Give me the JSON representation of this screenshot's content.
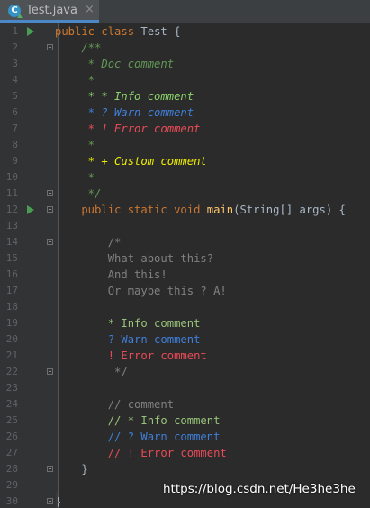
{
  "tab": {
    "title": "Test.java",
    "icon": "java-class-icon",
    "icon_letter": "C",
    "close": "×"
  },
  "colors": {
    "background": "#2b2b2b",
    "keyword": "#cc7832",
    "doc_comment": "#629755",
    "info": "#8bd46a",
    "warn": "#3f7fd9",
    "error": "#e84b57",
    "custom": "#f0f000"
  },
  "lines": [
    {
      "n": "1",
      "run": true,
      "fold": false,
      "tokens": [
        [
          "kw",
          "public class "
        ],
        [
          "plain",
          "Test {"
        ]
      ]
    },
    {
      "n": "2",
      "run": false,
      "fold": true,
      "tokens": [
        [
          "doc",
          "    /**"
        ]
      ]
    },
    {
      "n": "3",
      "run": false,
      "fold": false,
      "tokens": [
        [
          "doc",
          "     * Doc comment"
        ]
      ]
    },
    {
      "n": "4",
      "run": false,
      "fold": false,
      "tokens": [
        [
          "doc",
          "     *"
        ]
      ]
    },
    {
      "n": "5",
      "run": false,
      "fold": false,
      "tokens": [
        [
          "doc-info",
          "     * * Info comment"
        ]
      ]
    },
    {
      "n": "6",
      "run": false,
      "fold": false,
      "tokens": [
        [
          "doc-warn",
          "     * ? Warn comment"
        ]
      ]
    },
    {
      "n": "7",
      "run": false,
      "fold": false,
      "tokens": [
        [
          "doc-error",
          "     * ! Error comment"
        ]
      ]
    },
    {
      "n": "8",
      "run": false,
      "fold": false,
      "tokens": [
        [
          "doc",
          "     *"
        ]
      ]
    },
    {
      "n": "9",
      "run": false,
      "fold": false,
      "tokens": [
        [
          "doc-custom",
          "     * + Custom comment"
        ]
      ]
    },
    {
      "n": "10",
      "run": false,
      "fold": false,
      "tokens": [
        [
          "doc",
          "     *"
        ]
      ]
    },
    {
      "n": "11",
      "run": false,
      "fold": true,
      "tokens": [
        [
          "doc",
          "     */"
        ]
      ]
    },
    {
      "n": "12",
      "run": true,
      "fold": true,
      "tokens": [
        [
          "kw",
          "    public static void "
        ],
        [
          "fn",
          "main"
        ],
        [
          "plain",
          "(String[] args) {"
        ]
      ]
    },
    {
      "n": "13",
      "run": false,
      "fold": false,
      "tokens": [
        [
          "plain",
          ""
        ]
      ]
    },
    {
      "n": "14",
      "run": false,
      "fold": true,
      "tokens": [
        [
          "cm",
          "        /*"
        ]
      ]
    },
    {
      "n": "15",
      "run": false,
      "fold": false,
      "tokens": [
        [
          "cm",
          "        What about this?"
        ]
      ]
    },
    {
      "n": "16",
      "run": false,
      "fold": false,
      "tokens": [
        [
          "cm",
          "        And this!"
        ]
      ]
    },
    {
      "n": "17",
      "run": false,
      "fold": false,
      "tokens": [
        [
          "cm",
          "        Or maybe this ? A!"
        ]
      ]
    },
    {
      "n": "18",
      "run": false,
      "fold": false,
      "tokens": [
        [
          "cm",
          ""
        ]
      ]
    },
    {
      "n": "19",
      "run": false,
      "fold": false,
      "tokens": [
        [
          "cm-info",
          "        * Info comment"
        ]
      ]
    },
    {
      "n": "20",
      "run": false,
      "fold": false,
      "tokens": [
        [
          "cm-warn",
          "        ? Warn comment"
        ]
      ]
    },
    {
      "n": "21",
      "run": false,
      "fold": false,
      "tokens": [
        [
          "cm-error",
          "        ! Error comment"
        ]
      ]
    },
    {
      "n": "22",
      "run": false,
      "fold": true,
      "tokens": [
        [
          "cm",
          "         */"
        ]
      ]
    },
    {
      "n": "23",
      "run": false,
      "fold": false,
      "tokens": [
        [
          "plain",
          ""
        ]
      ]
    },
    {
      "n": "24",
      "run": false,
      "fold": false,
      "tokens": [
        [
          "cm",
          "        // comment"
        ]
      ]
    },
    {
      "n": "25",
      "run": false,
      "fold": false,
      "tokens": [
        [
          "cm-info",
          "        // * Info comment"
        ]
      ]
    },
    {
      "n": "26",
      "run": false,
      "fold": false,
      "tokens": [
        [
          "cm-warn",
          "        // ? Warn comment"
        ]
      ]
    },
    {
      "n": "27",
      "run": false,
      "fold": false,
      "tokens": [
        [
          "cm-error",
          "        // ! Error comment"
        ]
      ]
    },
    {
      "n": "28",
      "run": false,
      "fold": true,
      "tokens": [
        [
          "plain",
          "    }"
        ]
      ]
    },
    {
      "n": "29",
      "run": false,
      "fold": false,
      "tokens": [
        [
          "plain",
          ""
        ]
      ]
    },
    {
      "n": "30",
      "run": false,
      "fold": true,
      "tokens": [
        [
          "plain",
          "}"
        ]
      ]
    }
  ],
  "watermark": "https://blog.csdn.net/He3he3he"
}
